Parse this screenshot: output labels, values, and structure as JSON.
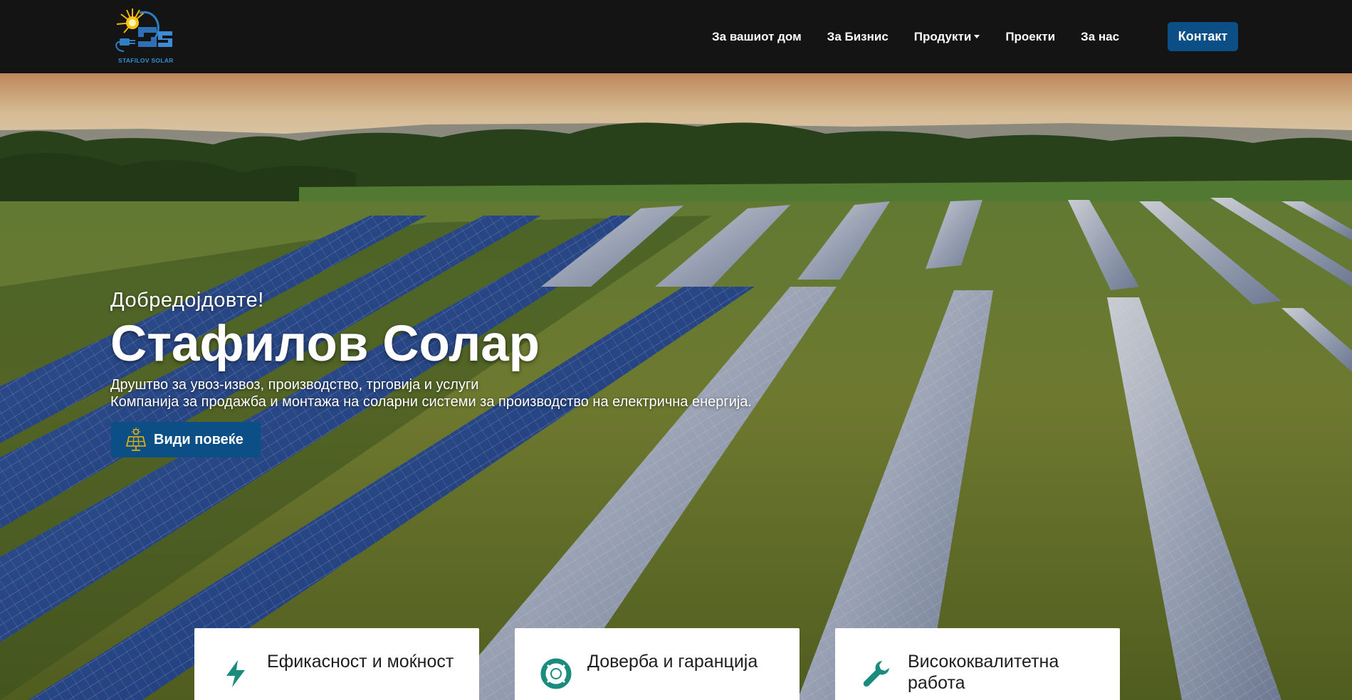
{
  "brand": {
    "logo_text": "STAFILOV SOLAR",
    "accent": "#0b4f86",
    "icon": "sun-plug-logo-icon"
  },
  "nav": {
    "items": [
      {
        "label": "За вашиот дом"
      },
      {
        "label": "За Бизнис"
      },
      {
        "label": "Продукти",
        "has_dropdown": true
      },
      {
        "label": "Проекти"
      },
      {
        "label": "За нас"
      }
    ],
    "contact_label": "Контакт"
  },
  "hero": {
    "welcome": "Добредојдовте!",
    "title": "Стафилов Солар",
    "subtitle_line1": "Друштво за увоз-извоз, производство, трговија и услуги",
    "subtitle_line2": "Компанија за продажба и монтажа на соларни системи за производство на електрична енергија.",
    "button_label": "Види повеќе",
    "button_icon": "solar-panel-icon"
  },
  "features": [
    {
      "title": "Ефикасност и моќност",
      "icon": "lightning-bolt-icon"
    },
    {
      "title": "Доверба и гаранција",
      "icon": "lifebuoy-icon"
    },
    {
      "title": "Висококвалитетна работа",
      "icon": "wrench-icon"
    }
  ],
  "colors": {
    "navbar": "#141414",
    "icon_teal": "#1a8c7e",
    "button": "#0b4f86"
  }
}
